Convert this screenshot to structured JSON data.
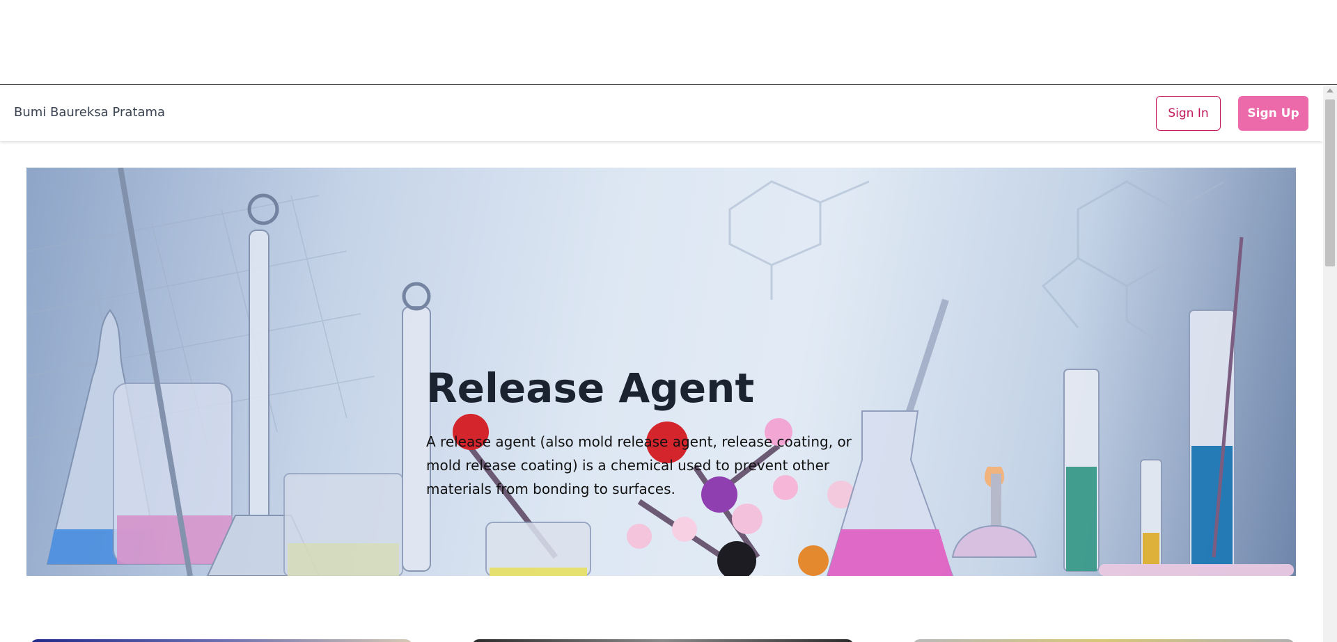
{
  "header": {
    "brand": "Bumi Baureksa Pratama",
    "sign_in_label": "Sign In",
    "sign_up_label": "Sign Up"
  },
  "hero": {
    "title": "Release Agent",
    "description": "A release agent (also mold release agent, release coating, or mold release coating) is a chemical used to prevent other materials from bonding to surfaces.",
    "image_icon": "laboratory-glassware-image"
  },
  "cards": [
    {
      "image_icon": "card-image"
    },
    {
      "image_icon": "card-image"
    },
    {
      "image_icon": "card-image"
    }
  ],
  "colors": {
    "brand_pink": "#ec6aa9",
    "outline_pink": "#c2185b",
    "text_dark": "#1c2330"
  }
}
